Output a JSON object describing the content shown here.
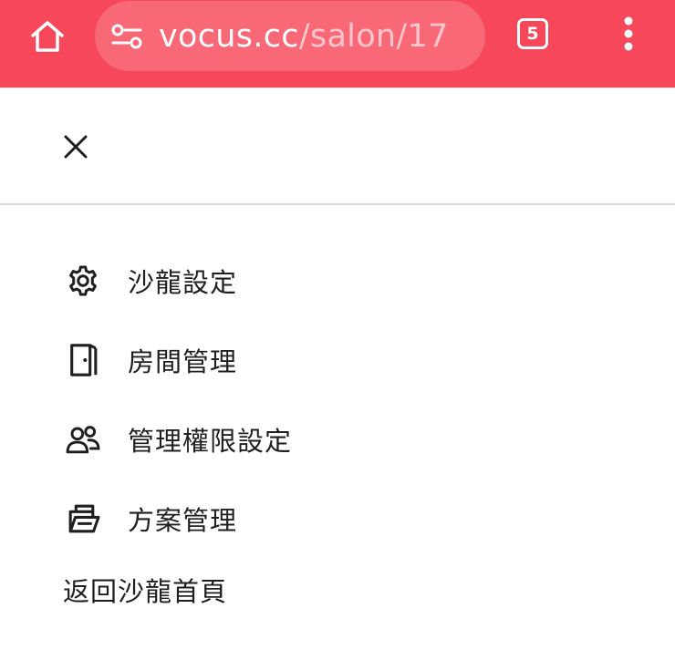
{
  "browser": {
    "url_host": "vocus.cc",
    "url_path": "/salon/17",
    "tab_count": "5",
    "accent_color": "#f7475a",
    "icons": {
      "home": "home-icon",
      "site_settings": "tune-icon",
      "menu": "more-vertical-icon"
    }
  },
  "drawer": {
    "close_icon": "close-icon",
    "items": [
      {
        "label": "沙龍設定",
        "icon": "gear-icon"
      },
      {
        "label": "房間管理",
        "icon": "door-icon"
      },
      {
        "label": "管理權限設定",
        "icon": "people-icon"
      },
      {
        "label": "方案管理",
        "icon": "plan-icon"
      }
    ],
    "back_label": "返回沙龍首頁"
  }
}
